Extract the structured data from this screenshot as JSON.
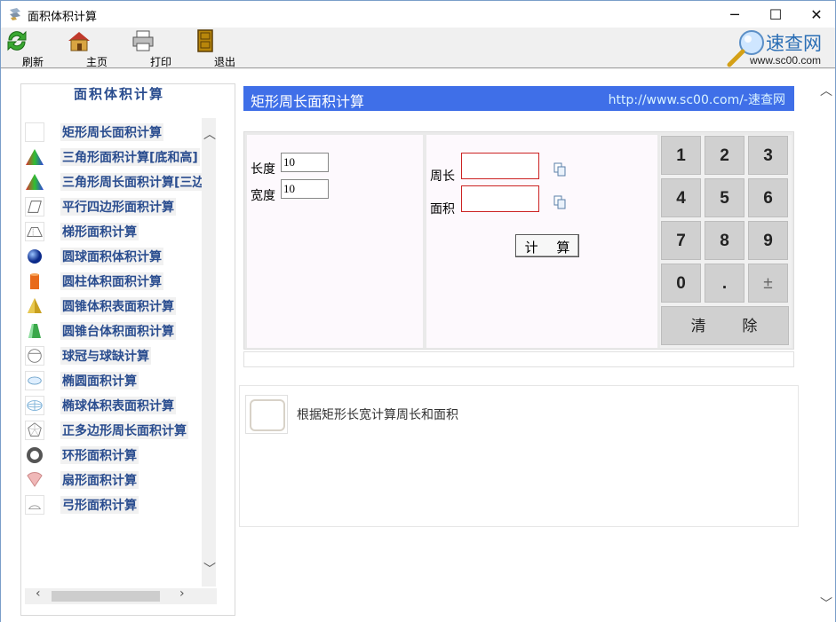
{
  "window": {
    "title": "面积体积计算",
    "controls": [
      "─",
      "☐",
      "✕"
    ]
  },
  "toolbar": {
    "refresh_label": "刷新",
    "home_label": "主页",
    "print_label": "打印",
    "exit_label": "退出"
  },
  "logo": {
    "text": "速查网",
    "url": "www.sc00.com"
  },
  "sidebar": {
    "title": "面积体积计算",
    "items": [
      {
        "label": "矩形周长面积计算",
        "icon": "rectangle-icon"
      },
      {
        "label": "三角形面积计算[底和高]",
        "icon": "triangle-icon"
      },
      {
        "label": "三角形周长面积计算[三边]",
        "icon": "triangle-icon"
      },
      {
        "label": "平行四边形面积计算",
        "icon": "parallelogram-icon"
      },
      {
        "label": "梯形面积计算",
        "icon": "trapezoid-icon"
      },
      {
        "label": "圆球面积体积计算",
        "icon": "sphere-icon"
      },
      {
        "label": "圆柱体积面积计算",
        "icon": "cylinder-icon"
      },
      {
        "label": "圆锥体积表面积计算",
        "icon": "cone-icon"
      },
      {
        "label": "圆锥台体积面积计算",
        "icon": "frustum-icon"
      },
      {
        "label": "球冠与球缺计算",
        "icon": "spherical-cap-icon"
      },
      {
        "label": "椭圆面积计算",
        "icon": "ellipse-icon"
      },
      {
        "label": "椭球体积表面积计算",
        "icon": "ellipsoid-icon"
      },
      {
        "label": "正多边形周长面积计算",
        "icon": "polygon-icon"
      },
      {
        "label": "环形面积计算",
        "icon": "ring-icon"
      },
      {
        "label": "扇形面积计算",
        "icon": "sector-icon"
      },
      {
        "label": "弓形面积计算",
        "icon": "segment-icon"
      }
    ]
  },
  "main": {
    "header_title": "矩形周长面积计算",
    "header_url": "http://www.sc00.com/-速查网",
    "inputs": {
      "length_label": "长度",
      "length_value": "10",
      "width_label": "宽度",
      "width_value": "10"
    },
    "results": {
      "perimeter_label": "周长",
      "perimeter_value": "",
      "area_label": "面积",
      "area_value": ""
    },
    "calc_button": "计 算",
    "keypad": [
      "1",
      "2",
      "3",
      "4",
      "5",
      "6",
      "7",
      "8",
      "9",
      "0",
      ".",
      "±"
    ],
    "clear_button": "清 除",
    "description": "根据矩形长宽计算周长和面积"
  }
}
